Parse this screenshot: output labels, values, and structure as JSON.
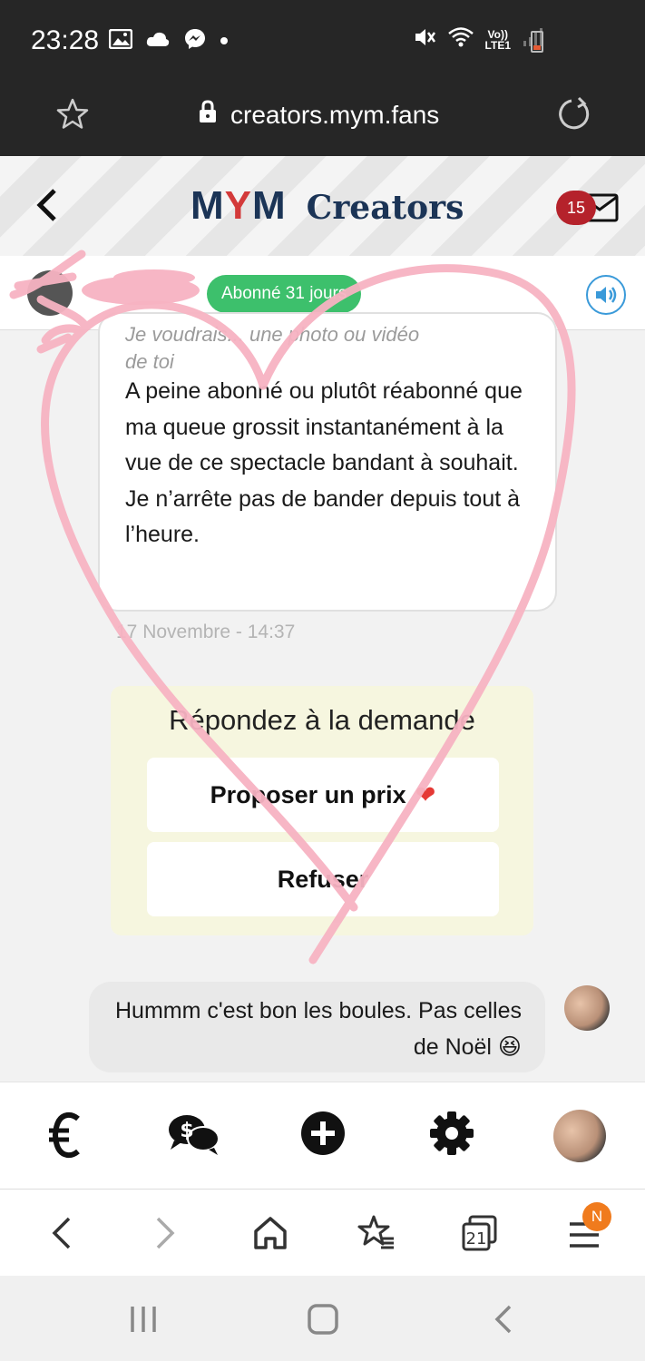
{
  "status_bar": {
    "time": "23:28",
    "network": "Vo))\nLTE1"
  },
  "browser": {
    "url": "creators.mym.fans"
  },
  "header": {
    "logo_mym_prefix": "M",
    "logo_mym_y": "Y",
    "logo_mym_suffix": "M",
    "logo_creators": "Creators",
    "mail_badge": "15"
  },
  "subscriber": {
    "status_pill": "Abonné 31 jours"
  },
  "conversation": {
    "incoming": {
      "quote_line1": "Je voudrais... une photo ou vidéo",
      "quote_line2": "de toi",
      "text": "A peine abonné ou plutôt réabonné que ma queue grossit instantanément à la vue de ce spectacle bandant à souhait. Je n’arrête pas de bander depuis tout à l’heure.",
      "timestamp": "17 Novembre - 14:37"
    },
    "request": {
      "title": "Répondez à la demande",
      "propose_label": "Proposer un prix",
      "refuse_label": "Refuser"
    },
    "outgoing": {
      "text": "Hummm c'est bon les boules. Pas celles de Noël 😆"
    }
  },
  "bottom_nav": {
    "items": [
      "euro-icon",
      "paid-chat-icon",
      "add-icon",
      "settings-icon",
      "profile-avatar"
    ]
  },
  "browser_toolbar": {
    "tabs_count": "21",
    "menu_badge": "N"
  },
  "colors": {
    "status_pill": "#3dc06c",
    "mail_badge": "#b5222b",
    "request_bg": "#f6f6df",
    "overlay_pink": "#f7b3c2",
    "logo_navy": "#1b3456",
    "logo_red": "#d33a3a",
    "browser_badge": "#f07b1d"
  }
}
